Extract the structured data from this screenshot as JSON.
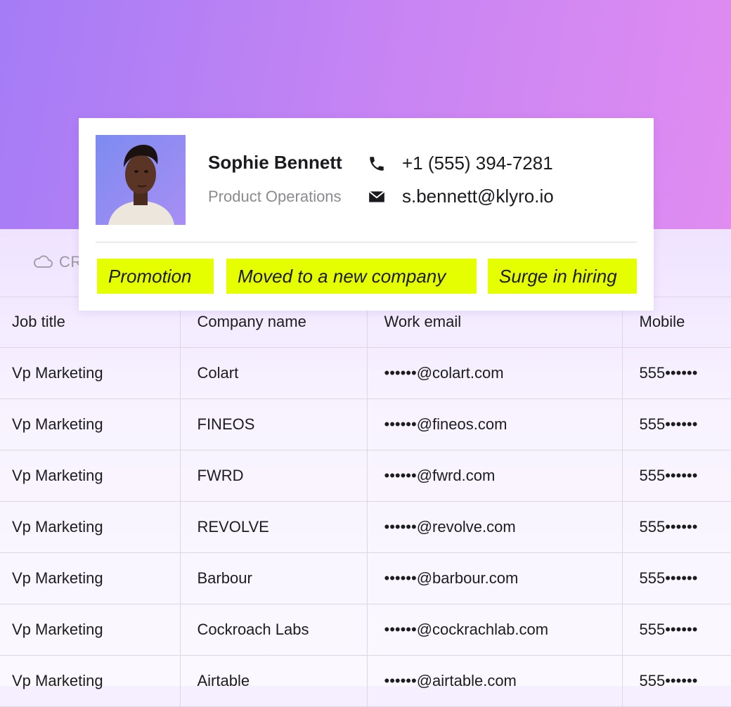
{
  "profile": {
    "name": "Sophie Bennett",
    "role": "Product Operations",
    "phone": "+1 (555) 394-7281",
    "email": "s.bennett@klyro.io",
    "phone_icon": "phone-icon",
    "email_icon": "mail-icon"
  },
  "signals": [
    {
      "label": "Promotion"
    },
    {
      "label": "Moved to a new company"
    },
    {
      "label": "Surge in hiring"
    }
  ],
  "toolbar": {
    "icon": "cloud-icon",
    "label": "CR"
  },
  "table": {
    "headers": [
      "Job title",
      "Company name",
      "Work email",
      "Mobile"
    ],
    "rows": [
      [
        "Vp Marketing",
        "Colart",
        "••••••@colart.com",
        "555••••••"
      ],
      [
        "Vp Marketing",
        "FINEOS",
        "••••••@fineos.com",
        "555••••••"
      ],
      [
        "Vp Marketing",
        "FWRD",
        "••••••@fwrd.com",
        "555••••••"
      ],
      [
        "Vp Marketing",
        "REVOLVE",
        "••••••@revolve.com",
        "555••••••"
      ],
      [
        "Vp Marketing",
        "Barbour",
        "••••••@barbour.com",
        "555••••••"
      ],
      [
        "Vp Marketing",
        "Cockroach Labs",
        "••••••@cockrachlab.com",
        "555••••••"
      ],
      [
        "Vp Marketing",
        "Airtable",
        "••••••@airtable.com",
        "555••••••"
      ]
    ]
  },
  "colors": {
    "gradient_start": "#a57cf6",
    "gradient_end": "#e08cf1",
    "tag_highlight": "#e6ff00",
    "table_bg": "#f6efff"
  }
}
